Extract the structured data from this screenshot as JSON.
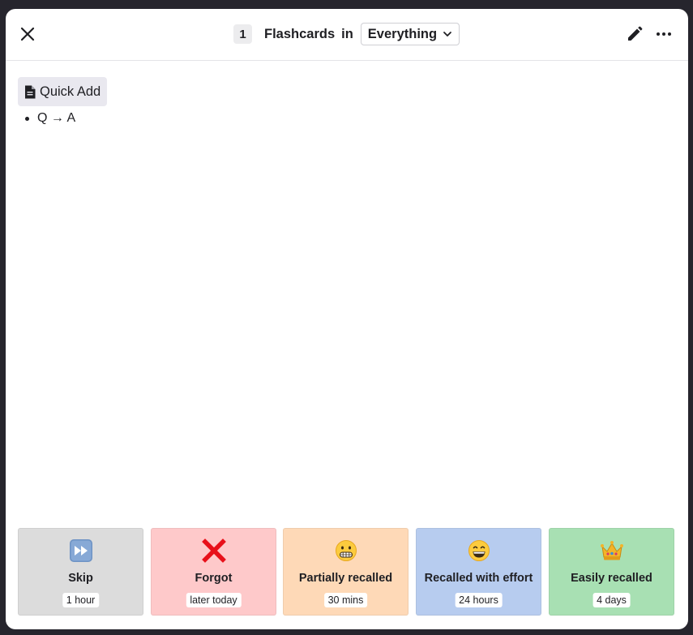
{
  "header": {
    "count": "1",
    "title": "Flashcards",
    "in_word": "in",
    "scope": "Everything"
  },
  "icons": {
    "close": "close-icon",
    "chevron": "chevron-down-icon",
    "edit": "pencil-icon",
    "more": "more-horizontal-icon",
    "document": "document-icon"
  },
  "content": {
    "quick_add_label": "Quick Add",
    "bullet_text": "Q → A"
  },
  "ratings": [
    {
      "label": "Skip",
      "interval": "1 hour",
      "color": "#dcdcdc",
      "icon": "fast-forward-emoji"
    },
    {
      "label": "Forgot",
      "interval": "later today",
      "color": "#fec9ca",
      "icon": "cross-mark-emoji"
    },
    {
      "label": "Partially recalled",
      "interval": "30 mins",
      "color": "#fed9b7",
      "icon": "grimacing-face-emoji"
    },
    {
      "label": "Recalled with effort",
      "interval": "24 hours",
      "color": "#b7ccef",
      "icon": "grinning-face-emoji"
    },
    {
      "label": "Easily recalled",
      "interval": "4 days",
      "color": "#a8e0b3",
      "icon": "crown-emoji"
    }
  ]
}
